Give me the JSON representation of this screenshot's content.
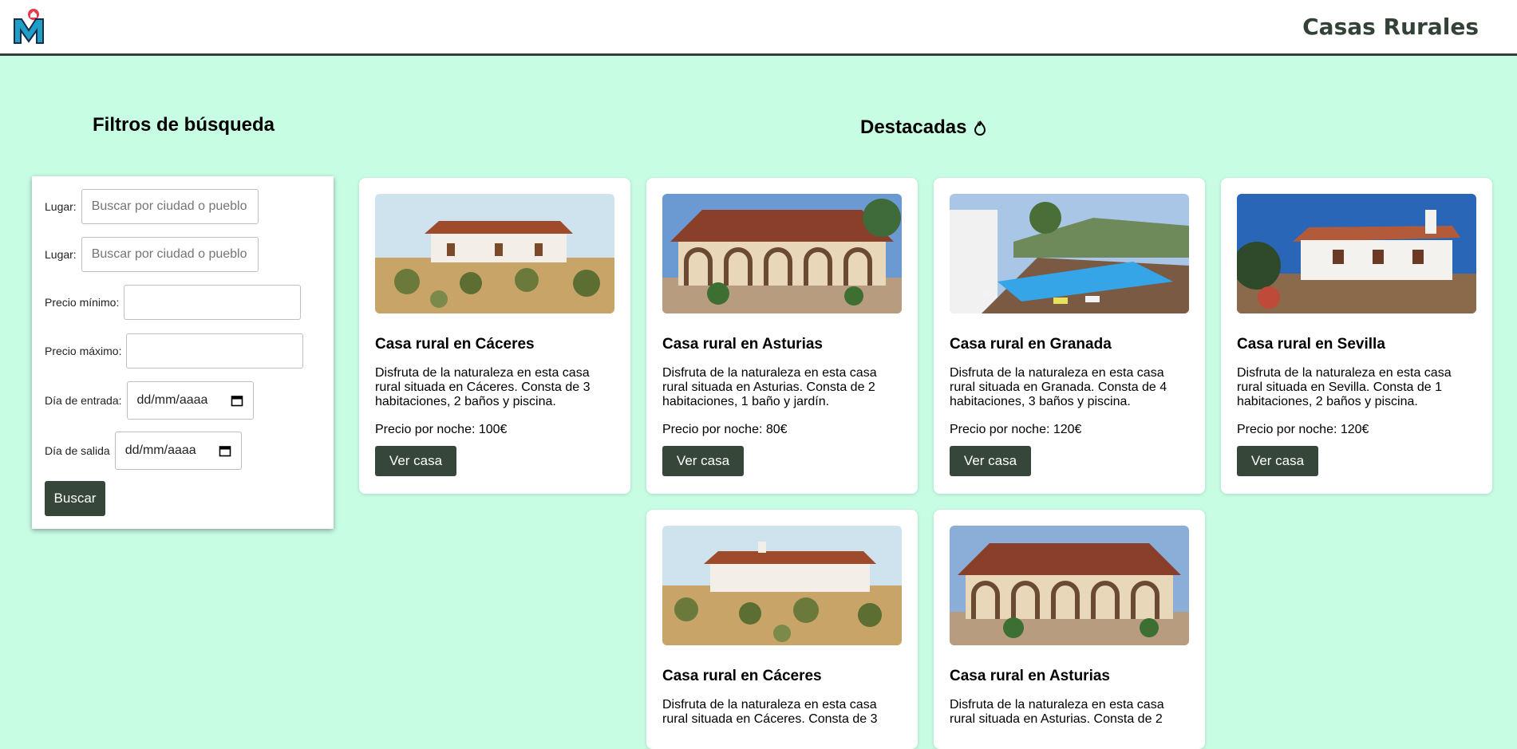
{
  "header": {
    "site_title": "Casas Rurales",
    "logo": "M-logo-icon"
  },
  "filters": {
    "title": "Filtros de búsqueda",
    "fields": [
      {
        "label": "Lugar:",
        "placeholder": "Buscar por ciudad o pueblo"
      },
      {
        "label": "Lugar:",
        "placeholder": "Buscar por ciudad o pueblo"
      },
      {
        "label": "Precio mínimo:",
        "placeholder": ""
      },
      {
        "label": "Precio máximo:",
        "placeholder": ""
      },
      {
        "label": "Día de entrada:",
        "placeholder": "dd/mm/aaaa"
      },
      {
        "label": "Día de salida",
        "placeholder": "dd/mm/aaaa"
      }
    ],
    "search_button": "Buscar"
  },
  "featured": {
    "title": "Destacadas",
    "icon": "fire-icon",
    "cards": [
      {
        "title": "Casa rural en Cáceres",
        "desc": "Disfruta de la naturaleza en esta casa rural situada en Cáceres. Consta de 3 habitaciones, 2 baños y piscina.",
        "price": "Precio por noche: 100€",
        "button": "Ver casa"
      },
      {
        "title": "Casa rural en Asturias",
        "desc": "Disfruta de la naturaleza en esta casa rural situada en Asturias. Consta de 2 habitaciones, 1 baño y jardín.",
        "price": "Precio por noche: 80€",
        "button": "Ver casa"
      },
      {
        "title": "Casa rural en Granada",
        "desc": "Disfruta de la naturaleza en esta casa rural situada en Granada. Consta de 4 habitaciones, 3 baños y piscina.",
        "price": "Precio por noche: 120€",
        "button": "Ver casa"
      },
      {
        "title": "Casa rural en Sevilla",
        "desc": "Disfruta de la naturaleza en esta casa rural situada en Sevilla. Consta de 1 habitaciones, 2 baños y piscina.",
        "price": "Precio por noche: 120€",
        "button": "Ver casa"
      },
      {
        "title": "Casa rural en Cáceres",
        "desc": "Disfruta de la naturaleza en esta casa rural situada en Cáceres. Consta de 3",
        "price": "",
        "button": ""
      },
      {
        "title": "Casa rural en Asturias",
        "desc": "Disfruta de la naturaleza en esta casa rural situada en Asturias. Consta de 2",
        "price": "",
        "button": ""
      }
    ]
  },
  "colors": {
    "background": "#c7fde3",
    "button": "#364638",
    "title": "#334236"
  }
}
